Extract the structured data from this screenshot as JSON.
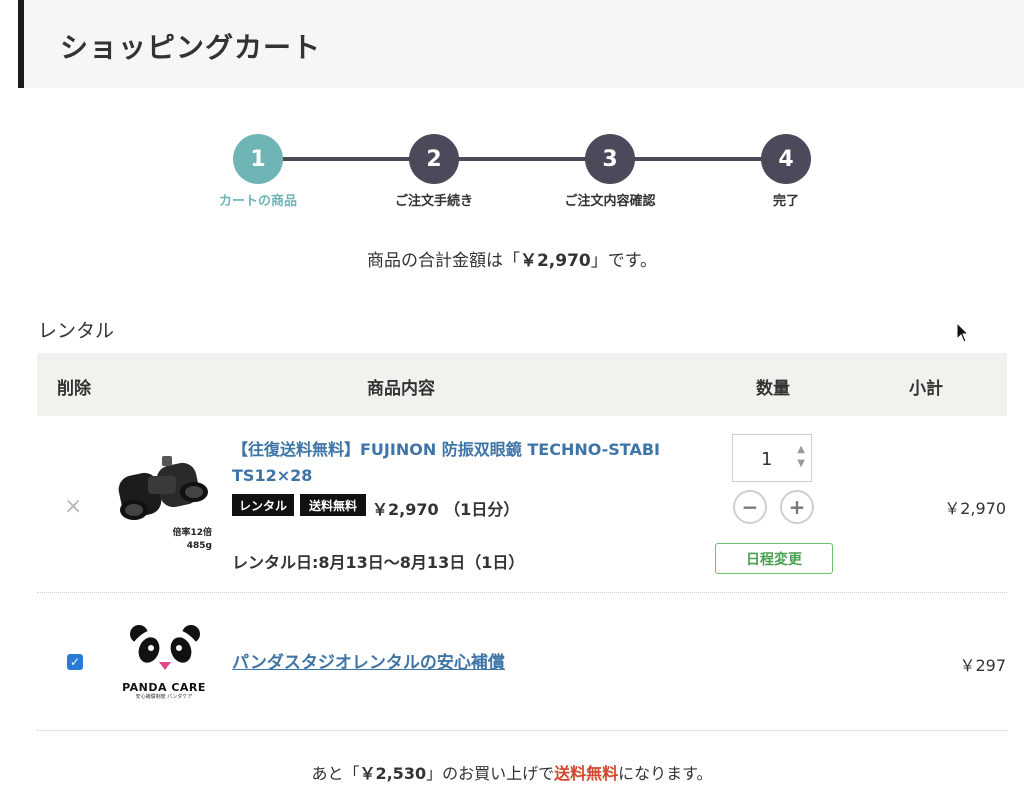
{
  "header": {
    "title": "ショッピングカート"
  },
  "steps": [
    {
      "num": "1",
      "label": "カートの商品",
      "active": true
    },
    {
      "num": "2",
      "label": "ご注文手続き"
    },
    {
      "num": "3",
      "label": "ご注文内容確認"
    },
    {
      "num": "4",
      "label": "完了"
    }
  ],
  "total": {
    "prefix": "商品の合計金額は「",
    "amount": "￥2,970",
    "suffix": "」です。"
  },
  "section": {
    "label": "レンタル"
  },
  "table": {
    "col_delete": "削除",
    "col_content": "商品内容",
    "col_qty": "数量",
    "col_subtotal": "小計"
  },
  "item1": {
    "remove": "×",
    "title": "【往復送料無料】FUJINON 防振双眼鏡 TECHNO-STABI TS12×28",
    "tag_rental": "レンタル",
    "tag_shipping": "送料無料",
    "price": "￥2,970 （1日分）",
    "img_mag": "倍率12倍",
    "img_weight": "485g",
    "rental_date": "レンタル日:8月13日〜8月13日（1日）",
    "qty": "1",
    "minus": "−",
    "plus": "+",
    "schedule": "日程変更",
    "subtotal": "￥2,970"
  },
  "item2": {
    "checked": "✓",
    "logo_text": "PANDA CARE",
    "logo_sub": "安心補償制度 パンダケア",
    "link": "パンダスタジオレンタルの安心補償",
    "subtotal": "￥297"
  },
  "footer": {
    "pre": "あと「",
    "amount": "￥2,530",
    "mid": "」のお買い上げで",
    "free": "送料無料",
    "post": "になります。"
  },
  "colors": {
    "accent": "#6fb5b5",
    "step": "#4a4a5a",
    "link": "#3f74a6",
    "green": "#6cc072",
    "red": "#d0482f"
  }
}
